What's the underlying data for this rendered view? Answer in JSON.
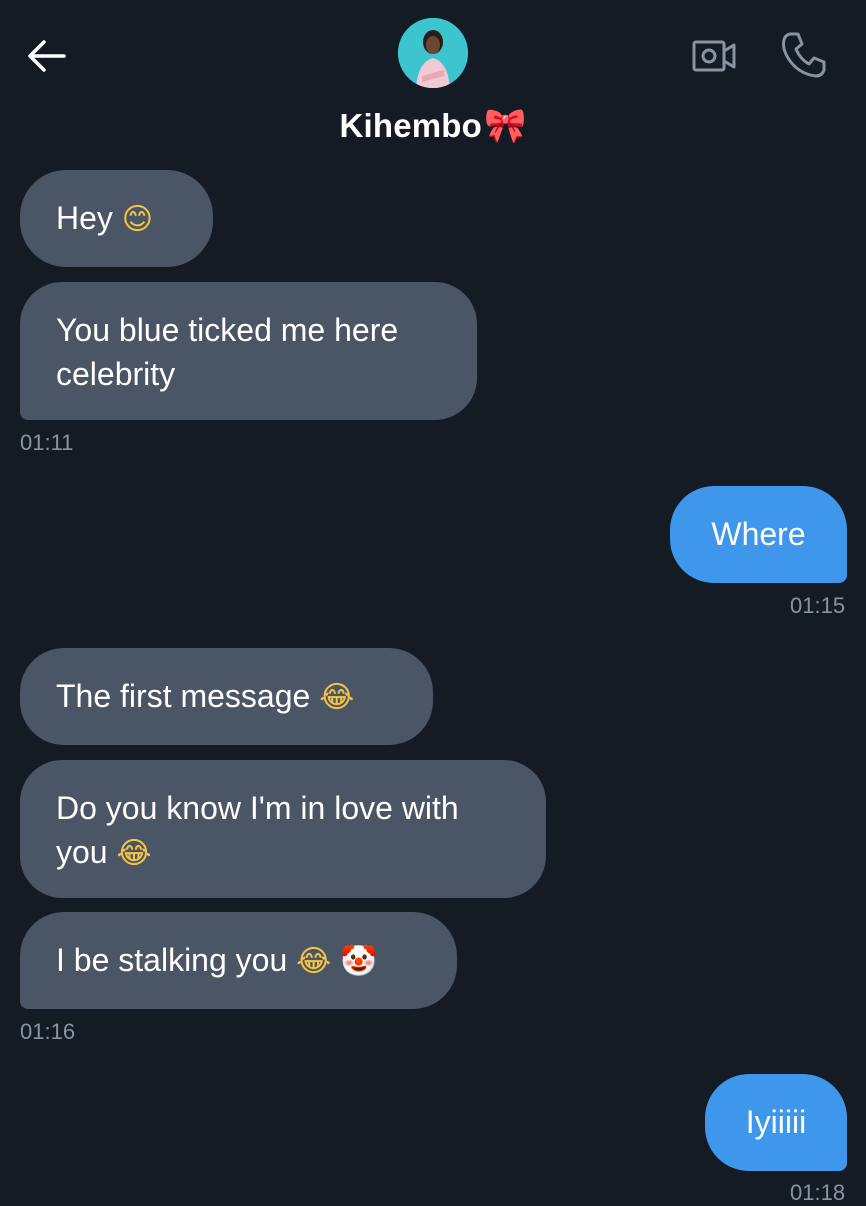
{
  "header": {
    "contact_name": "Kihembo",
    "name_emoji": "🎀"
  },
  "icons": {
    "back": "arrow-left-icon",
    "video": "video-camera-icon",
    "call": "phone-icon"
  },
  "colors": {
    "background": "#151b25",
    "incoming_bubble": "#4a5565",
    "outgoing_bubble": "#3e97ea",
    "timestamp": "#8893a3"
  },
  "messages": [
    {
      "direction": "in",
      "text": "Hey",
      "emoji": "😊"
    },
    {
      "direction": "in",
      "line1": "You blue ticked me here",
      "line2": "celebrity"
    },
    {
      "direction": "out",
      "text": "Where"
    },
    {
      "direction": "in",
      "text": "The first message",
      "emoji": "😂"
    },
    {
      "direction": "in",
      "line1": "Do you know I'm in love with",
      "line2": "you",
      "emoji": "😂"
    },
    {
      "direction": "in",
      "text": "I be stalking you",
      "emoji": "😂",
      "emoji2": "🤡"
    },
    {
      "direction": "out",
      "text": "Iyiiiii"
    }
  ],
  "timestamps": [
    "01:11",
    "01:15",
    "01:16",
    "01:18"
  ]
}
